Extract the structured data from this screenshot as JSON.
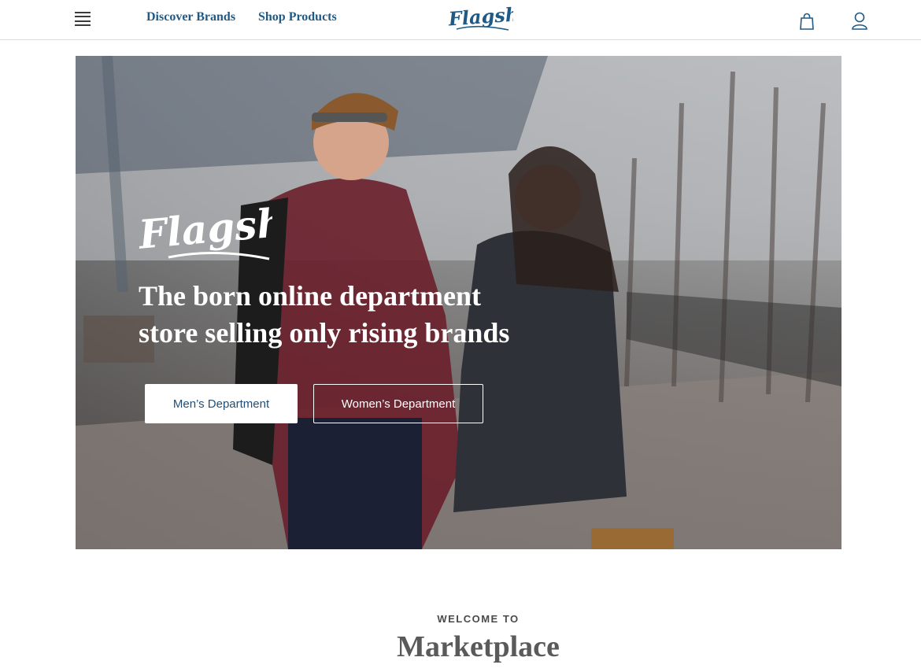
{
  "header": {
    "menu_icon": "hamburger-menu-icon",
    "nav": [
      {
        "label": "Discover Brands"
      },
      {
        "label": "Shop Products"
      }
    ],
    "logo_text": "Flagship",
    "cart_icon": "shopping-bag-icon",
    "account_icon": "user-icon",
    "accent_color": "#1f5a86"
  },
  "hero": {
    "logo_text": "Flagship",
    "heading_line1": "The born online department",
    "heading_line2": "store selling only rising brands",
    "buttons": {
      "men": "Men’s Department",
      "women": "Women’s Department"
    }
  },
  "welcome": {
    "label": "WELCOME TO",
    "title": "Marketplace"
  }
}
